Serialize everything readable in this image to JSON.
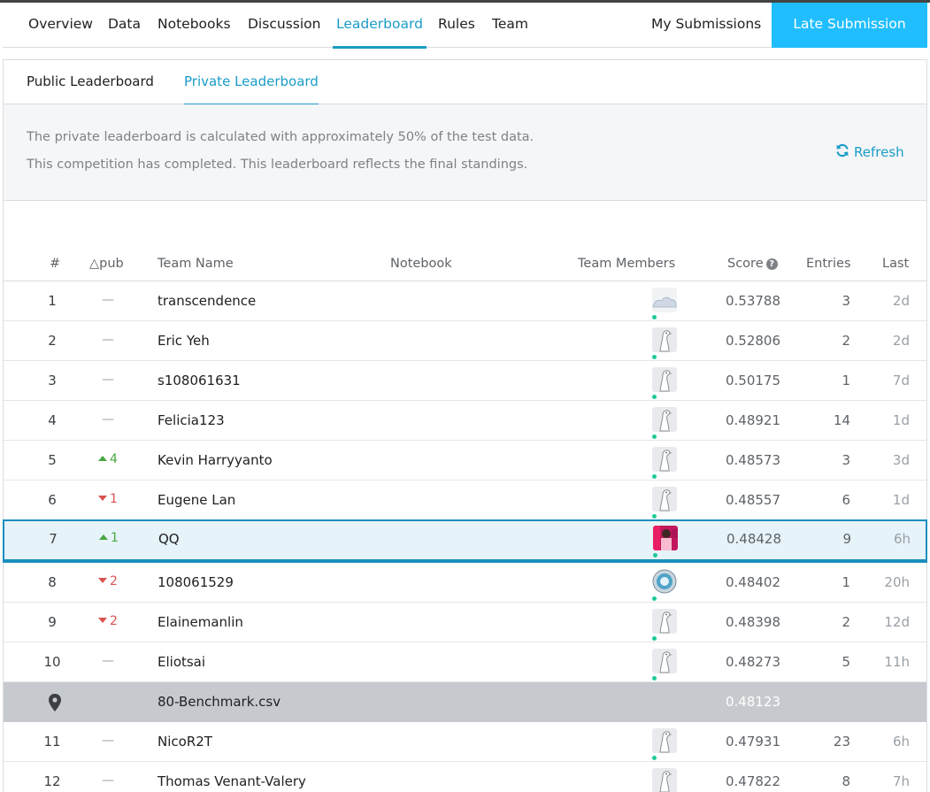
{
  "nav": {
    "tabs": [
      {
        "label": "Overview"
      },
      {
        "label": "Data"
      },
      {
        "label": "Notebooks"
      },
      {
        "label": "Discussion"
      },
      {
        "label": "Leaderboard"
      },
      {
        "label": "Rules"
      },
      {
        "label": "Team"
      }
    ],
    "active_tab": "Leaderboard",
    "my_submissions": "My Submissions",
    "late_submission": "Late Submission"
  },
  "leaderboard": {
    "tabs": [
      {
        "label": "Public Leaderboard"
      },
      {
        "label": "Private Leaderboard"
      }
    ],
    "active_tab": "Private Leaderboard",
    "info_line1": "The private leaderboard is calculated with approximately 50% of the test data.",
    "info_line2": "This competition has completed. This leaderboard reflects the final standings.",
    "refresh_label": "Refresh"
  },
  "table": {
    "headers": {
      "rank": "#",
      "delta": "△pub",
      "team_name": "Team Name",
      "notebook": "Notebook",
      "team_members": "Team Members",
      "score": "Score",
      "entries": "Entries",
      "last": "Last"
    },
    "rows": [
      {
        "rank": "1",
        "delta": "—",
        "change": "none",
        "team": "transcendence",
        "score": "0.53788",
        "entries": "3",
        "last": "2d",
        "avatar": "cloud"
      },
      {
        "rank": "2",
        "delta": "—",
        "change": "none",
        "team": "Eric Yeh",
        "score": "0.52806",
        "entries": "2",
        "last": "2d",
        "avatar": "default"
      },
      {
        "rank": "3",
        "delta": "—",
        "change": "none",
        "team": "s108061631",
        "score": "0.50175",
        "entries": "1",
        "last": "7d",
        "avatar": "default"
      },
      {
        "rank": "4",
        "delta": "—",
        "change": "none",
        "team": "Felicia123",
        "score": "0.48921",
        "entries": "14",
        "last": "1d",
        "avatar": "default"
      },
      {
        "rank": "5",
        "delta": "4",
        "change": "up",
        "team": "Kevin Harryyanto",
        "score": "0.48573",
        "entries": "3",
        "last": "3d",
        "avatar": "default"
      },
      {
        "rank": "6",
        "delta": "1",
        "change": "down",
        "team": "Eugene Lan",
        "score": "0.48557",
        "entries": "6",
        "last": "1d",
        "avatar": "default"
      },
      {
        "rank": "7",
        "delta": "1",
        "change": "up",
        "team": "QQ",
        "score": "0.48428",
        "entries": "9",
        "last": "6h",
        "avatar": "photo",
        "highlight": true
      },
      {
        "rank": "8",
        "delta": "2",
        "change": "down",
        "team": "108061529",
        "score": "0.48402",
        "entries": "1",
        "last": "20h",
        "avatar": "badge"
      },
      {
        "rank": "9",
        "delta": "2",
        "change": "down",
        "team": "Elainemanlin",
        "score": "0.48398",
        "entries": "2",
        "last": "12d",
        "avatar": "default"
      },
      {
        "rank": "10",
        "delta": "—",
        "change": "none",
        "team": "Eliotsai",
        "score": "0.48273",
        "entries": "5",
        "last": "11h",
        "avatar": "default"
      },
      {
        "benchmark": true,
        "team": "80-Benchmark.csv",
        "score": "0.48123"
      },
      {
        "rank": "11",
        "delta": "—",
        "change": "none",
        "team": "NicoR2T",
        "score": "0.47931",
        "entries": "23",
        "last": "6h",
        "avatar": "default"
      },
      {
        "rank": "12",
        "delta": "—",
        "change": "none",
        "team": "Thomas Venant-Valery",
        "score": "0.47822",
        "entries": "8",
        "last": "7h",
        "avatar": "default"
      }
    ]
  },
  "colors": {
    "accent": "#1a9cc7",
    "late_button": "#20beff",
    "up": "#49a742",
    "down": "#d9534f",
    "highlight_bg": "#e6f3f9",
    "benchmark_bg": "#c6cace"
  }
}
